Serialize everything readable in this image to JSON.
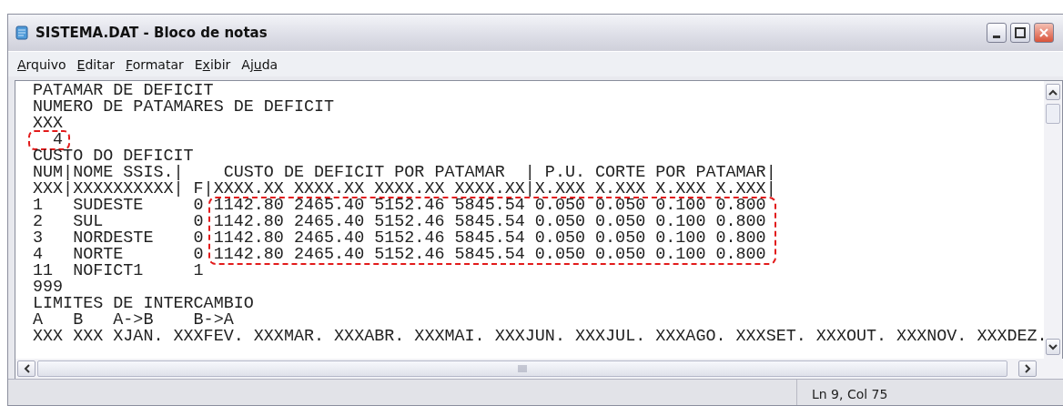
{
  "window": {
    "title": "SISTEMA.DAT - Bloco de notas"
  },
  "menu": [
    {
      "key": "A",
      "after": "rquivo"
    },
    {
      "key": "E",
      "after": "ditar"
    },
    {
      "key": "F",
      "after": "ormatar"
    },
    {
      "before": "E",
      "key": "x",
      "after": "ibir"
    },
    {
      "before": "Aj",
      "key": "u",
      "after": "da"
    }
  ],
  "lines": [
    "PATAMAR DE DEFICIT",
    "NUMERO DE PATAMARES DE DEFICIT",
    "XXX",
    "  4",
    "CUSTO DO DEFICIT",
    "NUM|NOME SSIS.|    CUSTO DE DEFICIT POR PATAMAR  | P.U. CORTE POR PATAMAR|",
    "XXX|XXXXXXXXXX| F|XXXX.XX XXXX.XX XXXX.XX XXXX.XX|X.XXX X.XXX X.XXX X.XXX|",
    "1   SUDESTE     0 1142.80 2465.40 5152.46 5845.54 0.050 0.050 0.100 0.800",
    "2   SUL         0 1142.80 2465.40 5152.46 5845.54 0.050 0.050 0.100 0.800",
    "3   NORDESTE    0 1142.80 2465.40 5152.46 5845.54 0.050 0.050 0.100 0.800",
    "4   NORTE       0 1142.80 2465.40 5152.46 5845.54 0.050 0.050 0.100 0.800",
    "11  NOFICT1     1",
    "999",
    "LIMITES DE INTERCAMBIO",
    "A   B   A->B    B->A",
    "XXX XXX XJAN. XXXFEV. XXXMAR. XXXABR. XXXMAI. XXXJUN. XXXJUL. XXXAGO. XXXSET. XXXOUT. XXXNOV. XXXDEZ."
  ],
  "status_bar": {
    "position": "Ln 9, Col 75"
  }
}
